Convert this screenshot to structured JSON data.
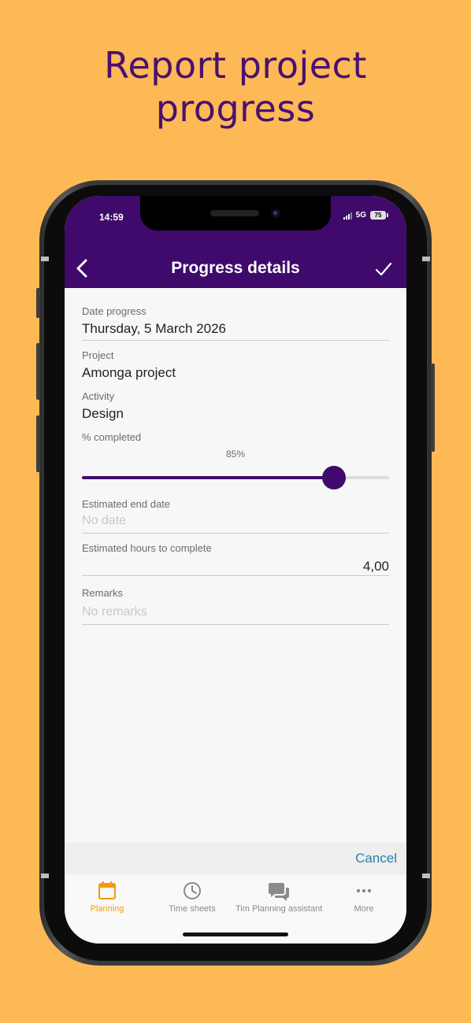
{
  "headline": {
    "line1": "Report project",
    "line2": "progress"
  },
  "status_bar": {
    "time": "14:59",
    "network": "5G",
    "battery": "75"
  },
  "nav": {
    "title": "Progress details",
    "back_icon": "chevron-left-icon",
    "save_icon": "checkmark-icon"
  },
  "form": {
    "date_progress_label": "Date progress",
    "date_progress_value": "Thursday, 5 March 2026",
    "project_label": "Project",
    "project_value": "Amonga project",
    "activity_label": "Activity",
    "activity_value": "Design",
    "percent_label": "% completed",
    "percent_value_text": "85%",
    "percent_value": 0.82,
    "end_date_label": "Estimated end date",
    "end_date_placeholder": "No date",
    "hours_label": "Estimated hours to complete",
    "hours_value": "4,00",
    "remarks_label": "Remarks",
    "remarks_placeholder": "No remarks"
  },
  "actions": {
    "cancel_label": "Cancel"
  },
  "tabs": [
    {
      "label": "Planning",
      "icon": "calendar-icon",
      "active": true
    },
    {
      "label": "Time sheets",
      "icon": "clock-icon",
      "active": false
    },
    {
      "label": "Tim Planning assistant",
      "icon": "chat-bubbles-icon",
      "active": false
    },
    {
      "label": "More",
      "icon": "more-dots-icon",
      "active": false
    }
  ],
  "colors": {
    "background": "#fcb955",
    "brand": "#3f0a6b",
    "accent": "#f39a11",
    "link": "#2a7fb0"
  }
}
